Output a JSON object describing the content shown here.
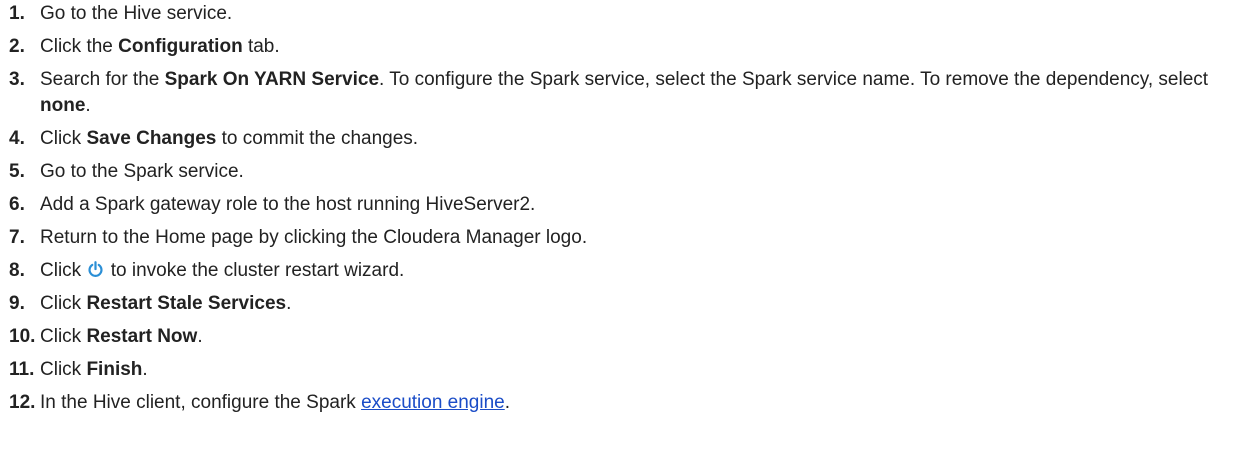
{
  "steps": [
    {
      "num": "1.",
      "parts": [
        {
          "t": "Go to the Hive service."
        }
      ]
    },
    {
      "num": "2.",
      "parts": [
        {
          "t": "Click the "
        },
        {
          "t": "Configuration",
          "b": true
        },
        {
          "t": " tab."
        }
      ]
    },
    {
      "num": "3.",
      "parts": [
        {
          "t": "Search for the "
        },
        {
          "t": "Spark On YARN Service",
          "b": true
        },
        {
          "t": ". To configure the Spark service, select the Spark service name. To remove the dependency, select "
        },
        {
          "t": "none",
          "b": true
        },
        {
          "t": "."
        }
      ]
    },
    {
      "num": "4.",
      "parts": [
        {
          "t": "Click "
        },
        {
          "t": "Save Changes",
          "b": true
        },
        {
          "t": " to commit the changes."
        }
      ]
    },
    {
      "num": "5.",
      "parts": [
        {
          "t": "Go to the Spark service."
        }
      ]
    },
    {
      "num": "6.",
      "parts": [
        {
          "t": "Add a Spark gateway role to the host running HiveServer2."
        }
      ]
    },
    {
      "num": "7.",
      "parts": [
        {
          "t": "Return to the Home page by clicking the Cloudera Manager logo."
        }
      ]
    },
    {
      "num": "8.",
      "parts": [
        {
          "t": "Click "
        },
        {
          "icon": "power-icon"
        },
        {
          "t": " to invoke the cluster restart wizard."
        }
      ]
    },
    {
      "num": "9.",
      "parts": [
        {
          "t": "Click "
        },
        {
          "t": "Restart Stale Services",
          "b": true
        },
        {
          "t": "."
        }
      ]
    },
    {
      "num": "10.",
      "parts": [
        {
          "t": "Click "
        },
        {
          "t": "Restart Now",
          "b": true
        },
        {
          "t": "."
        }
      ]
    },
    {
      "num": "11.",
      "parts": [
        {
          "t": "Click "
        },
        {
          "t": "Finish",
          "b": true
        },
        {
          "t": "."
        }
      ]
    },
    {
      "num": "12.",
      "parts": [
        {
          "t": "In the Hive client, configure the Spark "
        },
        {
          "t": "execution engine",
          "link": true
        },
        {
          "t": "."
        }
      ]
    }
  ],
  "colors": {
    "text": "#222222",
    "link": "#1a4cc7",
    "icon": "#2b8fd6"
  }
}
